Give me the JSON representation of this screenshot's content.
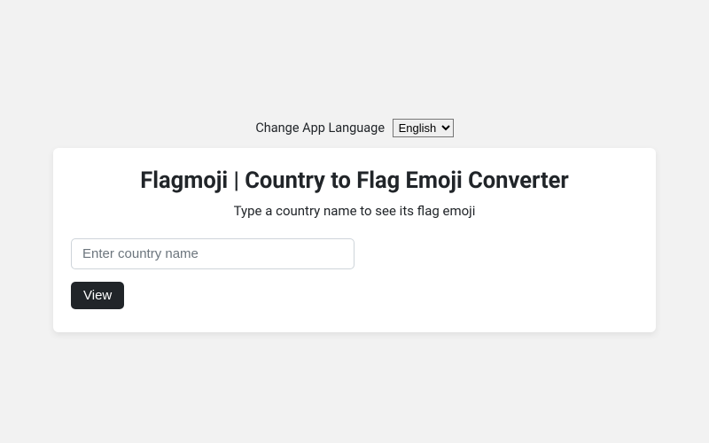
{
  "language": {
    "label": "Change App Language",
    "selected": "English"
  },
  "header": {
    "title": "Flagmoji | Country to Flag Emoji Converter",
    "subtitle": "Type a country name to see its flag emoji"
  },
  "form": {
    "placeholder": "Enter country name",
    "value": "",
    "button": "View"
  }
}
